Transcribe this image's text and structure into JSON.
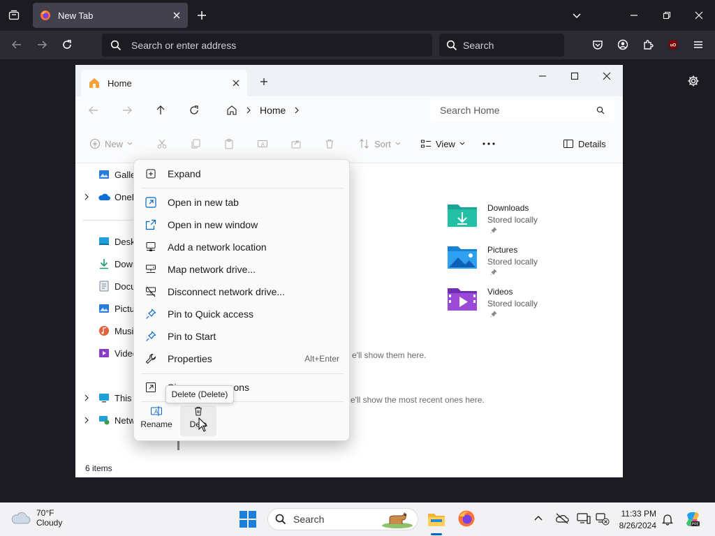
{
  "firefox": {
    "tab_title": "New Tab",
    "address_placeholder": "Search or enter address",
    "search_placeholder": "Search"
  },
  "explorer": {
    "tab_title": "Home",
    "address": {
      "crumb": "Home"
    },
    "search_placeholder": "Search Home",
    "toolbar": {
      "new_label": "New",
      "sort_label": "Sort",
      "view_label": "View",
      "details_label": "Details"
    },
    "sidebar": {
      "items": [
        {
          "label": "Galle",
          "icon": "gallery-icon"
        },
        {
          "label": "OneD",
          "icon": "onedrive-icon"
        },
        {
          "label": "Deskt",
          "icon": "desktop-icon"
        },
        {
          "label": "Dowr",
          "icon": "downloads-icon"
        },
        {
          "label": "Docu",
          "icon": "documents-icon"
        },
        {
          "label": "Pictu",
          "icon": "pictures-icon"
        },
        {
          "label": "Musi",
          "icon": "music-icon"
        },
        {
          "label": "Videc",
          "icon": "videos-icon"
        },
        {
          "label": "This I",
          "icon": "this-pc-icon"
        },
        {
          "label": "Netw",
          "icon": "network-icon"
        }
      ]
    },
    "tiles": [
      {
        "name": "Downloads",
        "status": "Stored locally",
        "icon": "downloads-folder-icon"
      },
      {
        "name": "Pictures",
        "status": "Stored locally",
        "icon": "pictures-folder-icon"
      },
      {
        "name": "Videos",
        "status": "Stored locally",
        "icon": "videos-folder-icon"
      }
    ],
    "empty_favorites": "e'll show them here.",
    "empty_recent": "e'll show the most recent ones here.",
    "status": "6 items"
  },
  "context_menu": {
    "items": [
      {
        "label": "Expand",
        "icon": "expand-icon"
      },
      {
        "label": "Open in new tab",
        "icon": "open-new-tab-icon"
      },
      {
        "label": "Open in new window",
        "icon": "open-new-window-icon"
      },
      {
        "label": "Add a network location",
        "icon": "network-location-icon"
      },
      {
        "label": "Map network drive...",
        "icon": "map-drive-icon"
      },
      {
        "label": "Disconnect network drive...",
        "icon": "disconnect-drive-icon"
      },
      {
        "label": "Pin to Quick access",
        "icon": "pin-icon"
      },
      {
        "label": "Pin to Start",
        "icon": "pin-start-icon"
      },
      {
        "label": "Properties",
        "icon": "wrench-icon",
        "shortcut": "Alt+Enter"
      },
      {
        "label": "Si",
        "label_tail": "ons",
        "icon": "show-more-options-icon"
      }
    ],
    "rename_label": "Rename",
    "delete_label": "Dele",
    "tooltip": "Delete (Delete)"
  },
  "taskbar": {
    "weather_temp": "70°F",
    "weather_desc": "Cloudy",
    "search_placeholder": "Search",
    "time": "11:33 PM",
    "date": "8/26/2024"
  },
  "colors": {
    "accent": "#0067c0",
    "firefox_bg": "#1c1b22",
    "folder_teal": "#1aa597"
  }
}
